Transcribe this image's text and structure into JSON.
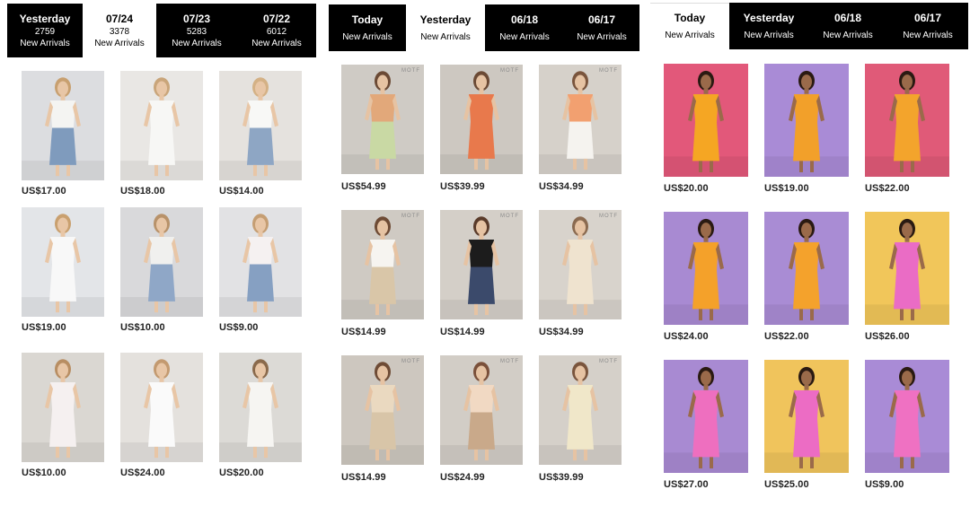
{
  "panels": [
    {
      "tabs": [
        {
          "label": "Yesterday",
          "count": "2759",
          "sub": "New Arrivals",
          "active": false
        },
        {
          "label": "07/24",
          "count": "3378",
          "sub": "New Arrivals",
          "active": true
        },
        {
          "label": "07/23",
          "count": "5283",
          "sub": "New Arrivals",
          "active": false
        },
        {
          "label": "07/22",
          "count": "6012",
          "sub": "New Arrivals",
          "active": false
        }
      ],
      "products": [
        {
          "price": "US$17.00",
          "colors": {
            "bg": "#dcdde0",
            "dress": "#f4f4f2",
            "skin": "#e8c6a6",
            "hair": "#c8a070",
            "bottom": "#7f9bbd"
          }
        },
        {
          "price": "US$18.00",
          "colors": {
            "bg": "#e9e7e4",
            "dress": "#f7f7f5",
            "skin": "#e8c6a6",
            "hair": "#c9a57a",
            "bottom": "#f7f7f5"
          }
        },
        {
          "price": "US$14.00",
          "colors": {
            "bg": "#e5e2de",
            "dress": "#f8f8f6",
            "skin": "#e8c6a6",
            "hair": "#d4b185",
            "bottom": "#8ea6c4"
          }
        },
        {
          "price": "US$19.00",
          "colors": {
            "bg": "#e3e5e8",
            "dress": "#f8f8f8",
            "skin": "#e8c6a6",
            "hair": "#c9a06f",
            "bottom": "#f8f8f8"
          }
        },
        {
          "price": "US$10.00",
          "colors": {
            "bg": "#d9d9db",
            "dress": "#f0f0ee",
            "skin": "#e8c6a6",
            "hair": "#b8926a",
            "bottom": "#8fa7c7"
          }
        },
        {
          "price": "US$9.00",
          "colors": {
            "bg": "#e2e2e4",
            "dress": "#f5f1f1",
            "skin": "#e8c6a6",
            "hair": "#c59e73",
            "bottom": "#86a0c2"
          }
        },
        {
          "price": "US$10.00",
          "colors": {
            "bg": "#dad7d2",
            "dress": "#f5f0f0",
            "skin": "#e8c6a6",
            "hair": "#b88e63",
            "bottom": "#f5f0f0"
          }
        },
        {
          "price": "US$24.00",
          "colors": {
            "bg": "#e4e1dd",
            "dress": "#fafafa",
            "skin": "#e8c6a6",
            "hair": "#c39a70",
            "bottom": "#fafafa"
          }
        },
        {
          "price": "US$20.00",
          "colors": {
            "bg": "#dcdad6",
            "dress": "#f6f5f2",
            "skin": "#e8c6a6",
            "hair": "#8a6a4c",
            "bottom": "#f6f5f2"
          }
        }
      ]
    },
    {
      "tabs": [
        {
          "label": "Today",
          "sub": "New Arrivals",
          "active": false
        },
        {
          "label": "Yesterday",
          "sub": "New Arrivals",
          "active": true
        },
        {
          "label": "06/18",
          "sub": "New Arrivals",
          "active": false
        },
        {
          "label": "06/17",
          "sub": "New Arrivals",
          "active": false
        }
      ],
      "brand": "MOTF",
      "products": [
        {
          "price": "US$54.99",
          "colors": {
            "bg": "#cfcbc5",
            "dress": "#e2a87a",
            "skin": "#e6c3a3",
            "hair": "#6b4a35",
            "bottom": "#c9d9a4"
          }
        },
        {
          "price": "US$39.99",
          "colors": {
            "bg": "#cdc8c1",
            "dress": "#e8794c",
            "skin": "#e6c3a3",
            "hair": "#6b4a35",
            "bottom": "#e8794c"
          }
        },
        {
          "price": "US$34.99",
          "colors": {
            "bg": "#d6d1ca",
            "dress": "#f2a070",
            "skin": "#e6c3a3",
            "hair": "#7a553d",
            "bottom": "#f5f3ef"
          }
        },
        {
          "price": "US$14.99",
          "colors": {
            "bg": "#cfcac3",
            "dress": "#f6f4f0",
            "skin": "#e6c3a3",
            "hair": "#6e4b35",
            "bottom": "#d9c6a8"
          }
        },
        {
          "price": "US$14.99",
          "colors": {
            "bg": "#d4cfc8",
            "dress": "#1c1c1c",
            "skin": "#e6c3a3",
            "hair": "#5a3b2a",
            "bottom": "#3b4a6b"
          }
        },
        {
          "price": "US$34.99",
          "colors": {
            "bg": "#d8d3cc",
            "dress": "#efe3cf",
            "skin": "#e6c3a3",
            "hair": "#8a6a50",
            "bottom": "#efe3cf"
          }
        },
        {
          "price": "US$14.99",
          "colors": {
            "bg": "#cdc7bf",
            "dress": "#ead9c0",
            "skin": "#e6c3a3",
            "hair": "#6e4b35",
            "bottom": "#d8c5a8"
          }
        },
        {
          "price": "US$24.99",
          "colors": {
            "bg": "#d2cdc6",
            "dress": "#f1d9c3",
            "skin": "#e6c3a3",
            "hair": "#7a503a",
            "bottom": "#c9a98a"
          }
        },
        {
          "price": "US$39.99",
          "colors": {
            "bg": "#d5d0c9",
            "dress": "#f0e7c9",
            "skin": "#e6c3a3",
            "hair": "#7a553d",
            "bottom": "#f0e7c9"
          }
        }
      ]
    },
    {
      "tabs": [
        {
          "label": "Today",
          "sub": "New Arrivals",
          "active": true
        },
        {
          "label": "Yesterday",
          "sub": "New Arrivals",
          "active": false
        },
        {
          "label": "06/18",
          "sub": "New Arrivals",
          "active": false
        },
        {
          "label": "06/17",
          "sub": "New Arrivals",
          "active": false
        }
      ],
      "products": [
        {
          "price": "US$20.00",
          "colors": {
            "bg": "#e2587a",
            "dress": "#f5a623",
            "skin": "#9a6a4a",
            "hair": "#2a1a12",
            "bottom": "#f5a623"
          }
        },
        {
          "price": "US$19.00",
          "colors": {
            "bg": "#a98bd6",
            "dress": "#f2a02a",
            "skin": "#9a6a4a",
            "hair": "#2a1a12",
            "bottom": "#f2a02a"
          }
        },
        {
          "price": "US$22.00",
          "colors": {
            "bg": "#e05a78",
            "dress": "#f3a42c",
            "skin": "#9a6a4a",
            "hair": "#2a1a12",
            "bottom": "#f3a42c"
          }
        },
        {
          "price": "US$24.00",
          "colors": {
            "bg": "#a88ad2",
            "dress": "#f4a12a",
            "skin": "#9a6a4a",
            "hair": "#2a1a12",
            "bottom": "#f4a12a"
          }
        },
        {
          "price": "US$22.00",
          "colors": {
            "bg": "#a98cd4",
            "dress": "#f4a22c",
            "skin": "#9a6a4a",
            "hair": "#2a1a12",
            "bottom": "#f4a22c"
          }
        },
        {
          "price": "US$26.00",
          "colors": {
            "bg": "#f1c65a",
            "dress": "#ea6cc5",
            "skin": "#9a6a4a",
            "hair": "#2a1a12",
            "bottom": "#ea6cc5"
          }
        },
        {
          "price": "US$27.00",
          "colors": {
            "bg": "#a88ad2",
            "dress": "#ee6fbf",
            "skin": "#9a6a4a",
            "hair": "#2a1a12",
            "bottom": "#ee6fbf"
          }
        },
        {
          "price": "US$25.00",
          "colors": {
            "bg": "#f0c45c",
            "dress": "#ec6cc4",
            "skin": "#9a6a4a",
            "hair": "#2a1a12",
            "bottom": "#ec6cc4"
          }
        },
        {
          "price": "US$9.00",
          "colors": {
            "bg": "#a98bd6",
            "dress": "#ef71c2",
            "skin": "#9a6a4a",
            "hair": "#2a1a12",
            "bottom": "#ef71c2"
          }
        }
      ]
    }
  ]
}
